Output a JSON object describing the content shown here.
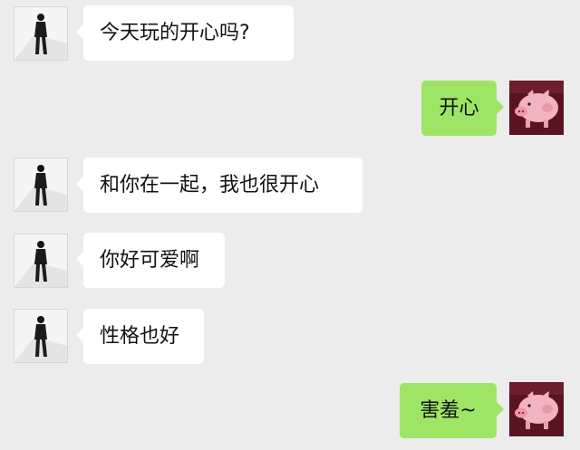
{
  "colors": {
    "background": "#ececec",
    "incoming_bubble": "#ffffff",
    "outgoing_bubble": "#9fe565"
  },
  "messages": [
    {
      "direction": "incoming",
      "text": "今天玩的开心吗?",
      "avatar": "person-photo"
    },
    {
      "direction": "outgoing",
      "text": "开心",
      "avatar": "pink-pig-icon"
    },
    {
      "direction": "incoming",
      "text": "和你在一起，我也很开心",
      "avatar": "person-photo"
    },
    {
      "direction": "incoming",
      "text": "你好可爱啊",
      "avatar": "person-photo"
    },
    {
      "direction": "incoming",
      "text": "性格也好",
      "avatar": "person-photo"
    },
    {
      "direction": "outgoing",
      "text": "害羞~",
      "avatar": "pink-pig-icon"
    }
  ]
}
